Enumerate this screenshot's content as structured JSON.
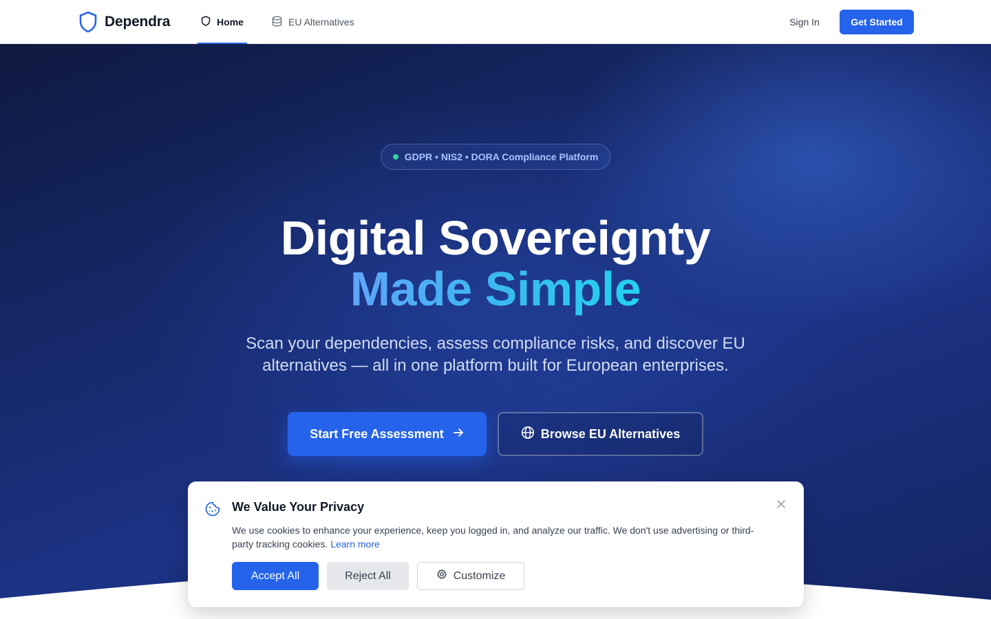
{
  "header": {
    "brand_name": "Dependra",
    "brand_icon": "shield-icon",
    "nav": [
      {
        "label": "Home",
        "icon": "shield-icon",
        "active": true
      },
      {
        "label": "EU Alternatives",
        "icon": "database-icon",
        "active": false
      }
    ],
    "sign_in_label": "Sign In",
    "get_started_label": "Get Started"
  },
  "hero": {
    "badge_text": "GDPR • NIS2 • DORA Compliance Platform",
    "title_line1": "Digital Sovereignty",
    "title_line2": "Made Simple",
    "subtitle": "Scan your dependencies, assess compliance risks, and discover EU alternatives — all in one platform built for European enterprises.",
    "primary_cta": "Start Free Assessment",
    "secondary_cta": "Browse EU Alternatives"
  },
  "cookie_banner": {
    "title": "We Value Your Privacy",
    "text": "We use cookies to enhance your experience, keep you logged in, and analyze our traffic. We don't use advertising or third-party tracking cookies.",
    "link_text": "Learn more",
    "accept_label": "Accept All",
    "reject_label": "Reject All",
    "customize_label": "Customize"
  },
  "colors": {
    "accent": "#2563eb",
    "hero_dark": "#16286a",
    "gradient_start": "#60a5fa",
    "gradient_end": "#22d3ee",
    "badge_dot": "#34d399"
  }
}
